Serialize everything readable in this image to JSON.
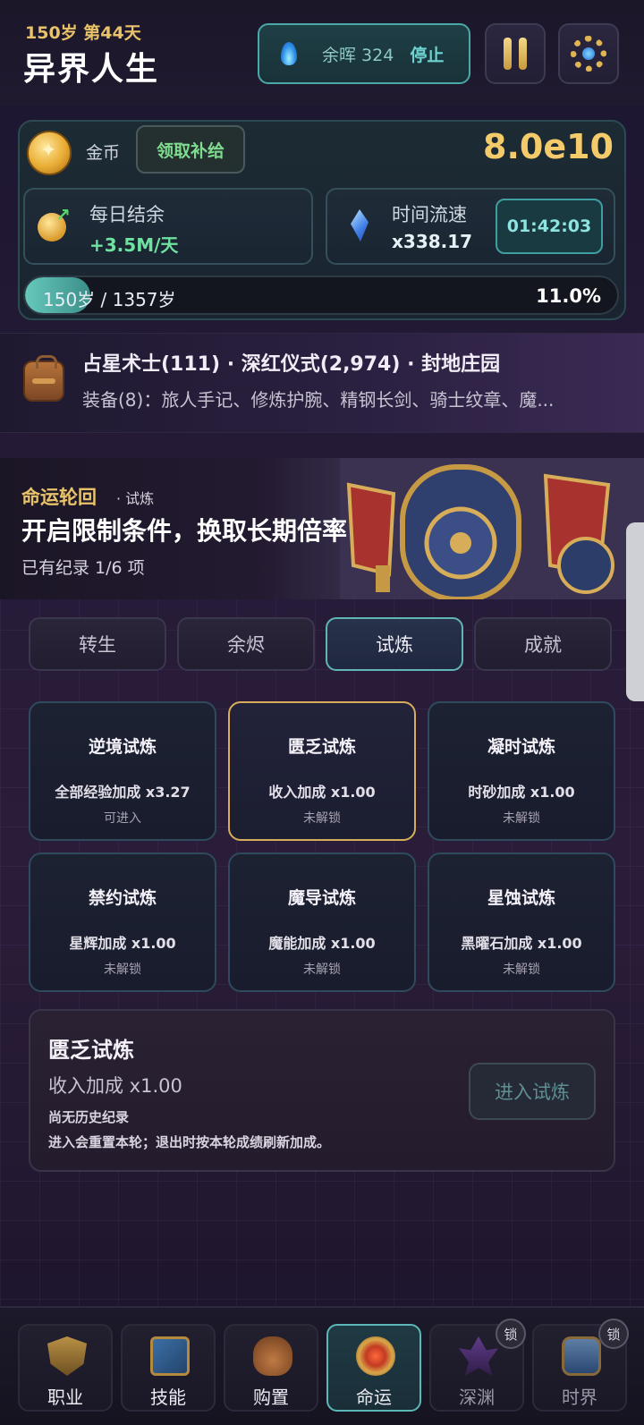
{
  "header": {
    "age_line": "150岁 第44天",
    "title": "异界人生",
    "ember_label": "余晖 324",
    "stop_label": "停止"
  },
  "resources": {
    "gold_label": "金币",
    "claim_label": "领取补给",
    "gold_value": "8.0e10",
    "daily_title": "每日结余",
    "daily_value": "+3.5M/天",
    "speed_title": "时间流速",
    "speed_value": "x338.17",
    "timer": "01:42:03",
    "age_progress_text": "150岁 / 1357岁",
    "age_progress_pct": "11.0%",
    "age_progress_fraction": 0.11
  },
  "inventory": {
    "line1": "占星术士(111) · 深红仪式(2,974) · 封地庄园",
    "line2": "装备(8)：旅人手记、修炼护腕、精钢长剑、骑士纹章、魔..."
  },
  "fate": {
    "kicker": "命运轮回",
    "sub": "· 试炼",
    "title": "开启限制条件，换取长期倍率",
    "record": "已有纪录 1/6 项"
  },
  "tabs": [
    {
      "label": "转生"
    },
    {
      "label": "余烬"
    },
    {
      "label": "试炼"
    },
    {
      "label": "成就"
    }
  ],
  "trials": [
    {
      "name": "逆境试炼",
      "bonus": "全部经验加成 x3.27",
      "status": "可进入"
    },
    {
      "name": "匮乏试炼",
      "bonus": "收入加成 x1.00",
      "status": "未解锁"
    },
    {
      "name": "凝时试炼",
      "bonus": "时砂加成 x1.00",
      "status": "未解锁"
    },
    {
      "name": "禁约试炼",
      "bonus": "星辉加成 x1.00",
      "status": "未解锁"
    },
    {
      "name": "魔导试炼",
      "bonus": "魔能加成 x1.00",
      "status": "未解锁"
    },
    {
      "name": "星蚀试炼",
      "bonus": "黑曜石加成 x1.00",
      "status": "未解锁"
    }
  ],
  "detail": {
    "title": "匮乏试炼",
    "bonus": "收入加成 x1.00",
    "history": "尚无历史纪录",
    "note": "进入会重置本轮；退出时按本轮成绩刷新加成。",
    "enter_label": "进入试炼"
  },
  "nav": [
    {
      "label": "职业",
      "icon": "shield-sword-icon"
    },
    {
      "label": "技能",
      "icon": "spellbook-icon"
    },
    {
      "label": "购置",
      "icon": "merchant-bag-icon"
    },
    {
      "label": "命运",
      "icon": "fate-wheel-icon"
    },
    {
      "label": "深渊",
      "icon": "abyss-crystal-icon",
      "lock": "锁"
    },
    {
      "label": "时界",
      "icon": "hourglass-icon",
      "lock": "锁"
    }
  ],
  "colors": {
    "accent_gold": "#e9c36a",
    "accent_teal": "#5fb6b3",
    "positive_green": "#6ee3a0"
  }
}
